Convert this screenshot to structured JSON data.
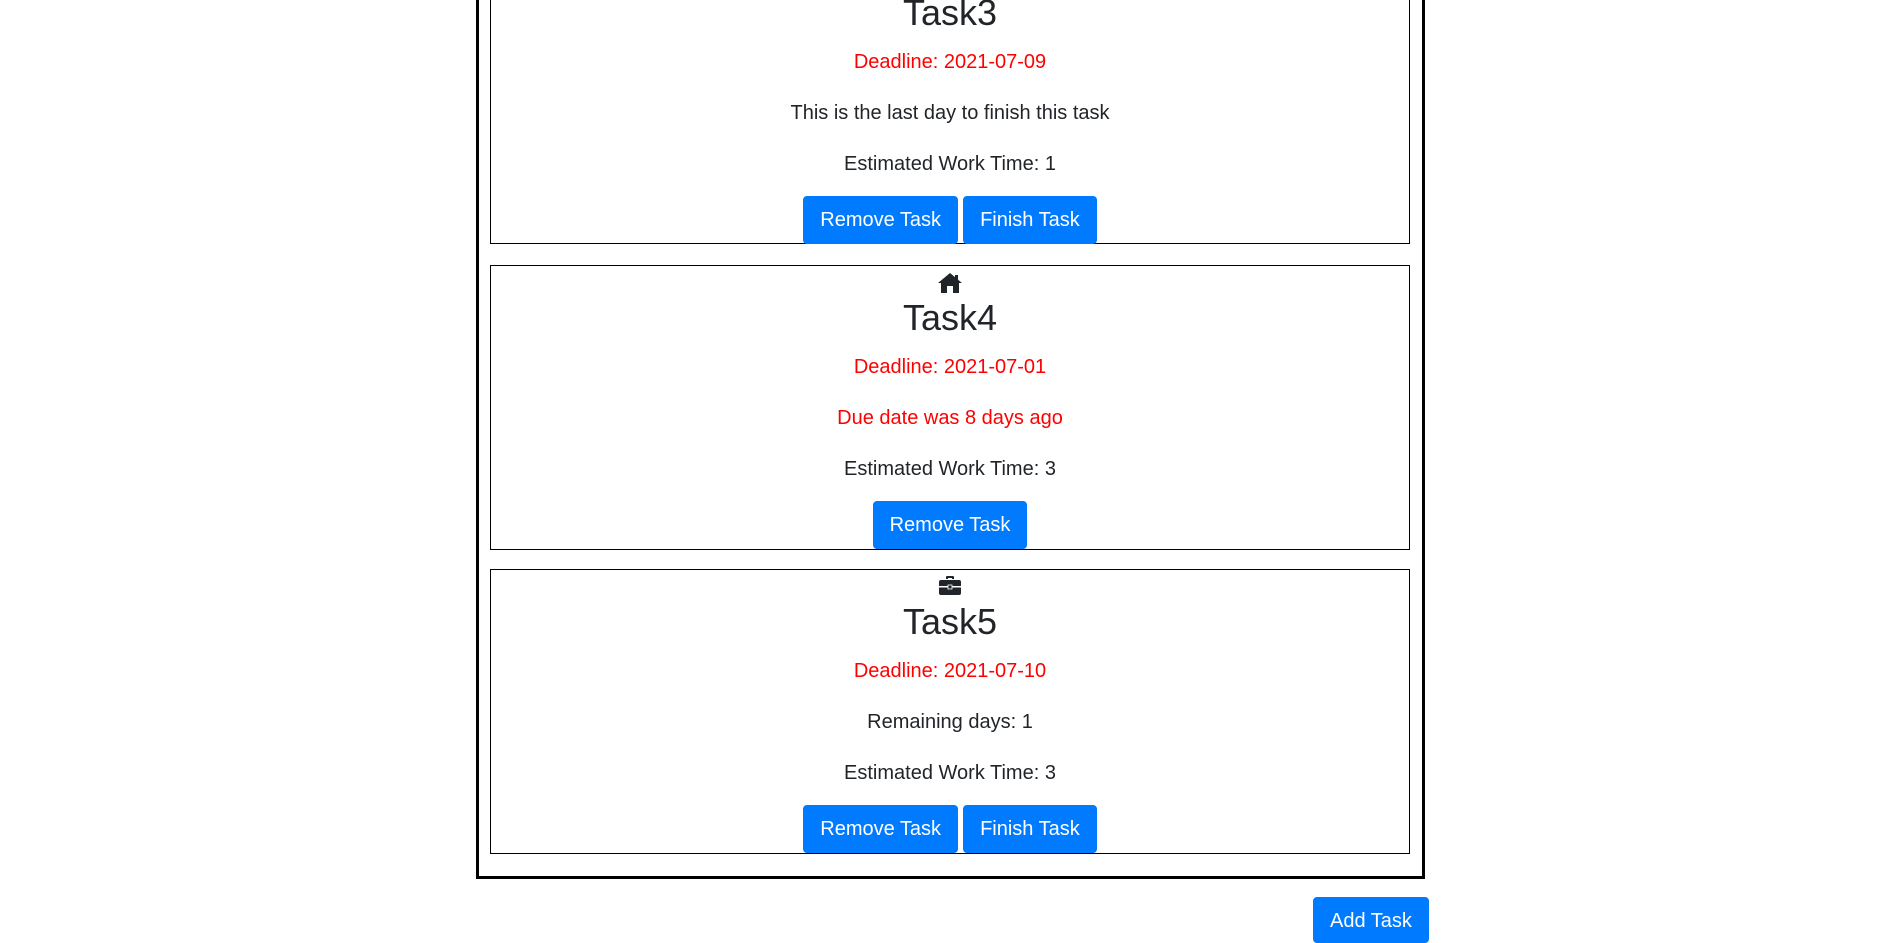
{
  "tasks": [
    {
      "title": "Task3",
      "deadline": "Deadline: 2021-07-09",
      "status": "This is the last day to finish this task",
      "work_time": "Estimated Work Time: 1",
      "remove_label": "Remove Task",
      "finish_label": "Finish Task"
    },
    {
      "icon": "home-icon",
      "title": "Task4",
      "deadline": "Deadline: 2021-07-01",
      "status": "Due date was 8 days ago",
      "work_time": "Estimated Work Time: 3",
      "remove_label": "Remove Task"
    },
    {
      "icon": "briefcase-icon",
      "title": "Task5",
      "deadline": "Deadline: 2021-07-10",
      "status": "Remaining days: 1",
      "work_time": "Estimated Work Time: 3",
      "remove_label": "Remove Task",
      "finish_label": "Finish Task"
    }
  ],
  "add_task_label": "Add Task",
  "colors": {
    "button": "#007bff",
    "deadline": "#ff0000",
    "text": "#212529"
  }
}
